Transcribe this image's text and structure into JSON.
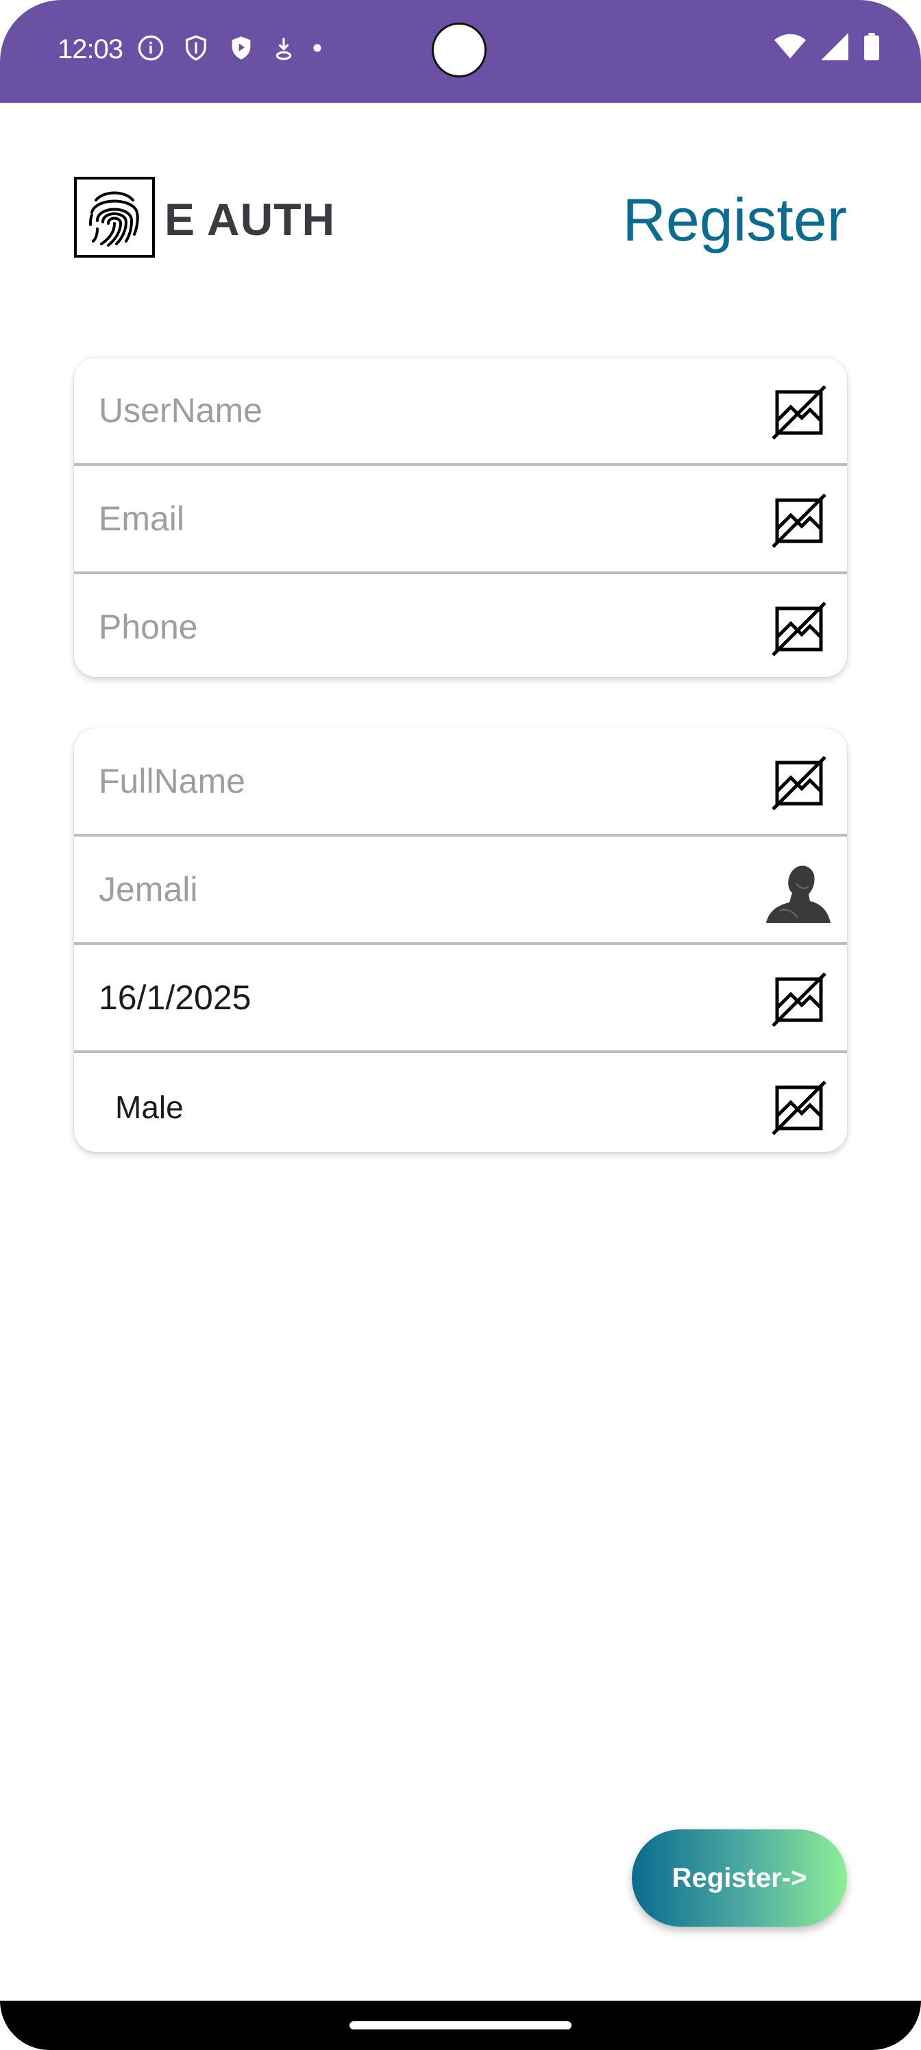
{
  "status_bar": {
    "time": "12:03",
    "left_icons": [
      "info-icon",
      "shield-outline-icon",
      "shield-play-icon",
      "download-icon",
      "dot-icon"
    ],
    "right_icons": [
      "wifi-icon",
      "signal-icon",
      "battery-icon"
    ],
    "background_color": "#6a51a3"
  },
  "header": {
    "logo_icon": "fingerprint-icon",
    "logo_text": "E AUTH",
    "title": "Register",
    "title_color": "#0c6b8e"
  },
  "account_card": {
    "fields": [
      {
        "placeholder": "UserName",
        "value": "",
        "icon": "broken-image-icon"
      },
      {
        "placeholder": "Email",
        "value": "",
        "icon": "broken-image-icon"
      },
      {
        "placeholder": "Phone",
        "value": "",
        "icon": "broken-image-icon"
      }
    ]
  },
  "profile_card": {
    "fields": [
      {
        "placeholder": "FullName",
        "value": "",
        "icon": "broken-image-icon"
      },
      {
        "placeholder": "Jemali",
        "value": "",
        "icon": "avatar-photo-icon"
      },
      {
        "placeholder": "",
        "value": "16/1/2025",
        "icon": "broken-image-icon"
      },
      {
        "placeholder": "",
        "value": "Male",
        "icon": "broken-image-icon"
      }
    ]
  },
  "actions": {
    "register_label": "Register->",
    "gradient_start": "#0b6b8f",
    "gradient_end": "#8fed98"
  }
}
